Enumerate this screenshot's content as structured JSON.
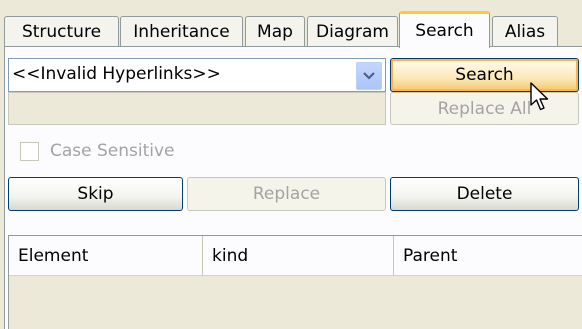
{
  "tabs": [
    {
      "label": "Structure"
    },
    {
      "label": "Inheritance"
    },
    {
      "label": "Map"
    },
    {
      "label": "Diagram"
    },
    {
      "label": "Search",
      "active": true
    },
    {
      "label": "Alias"
    }
  ],
  "search": {
    "combo_value": "<<Invalid Hyperlinks>>",
    "replace_value": "",
    "case_sensitive_label": "Case Sensitive",
    "case_sensitive_checked": false
  },
  "buttons": {
    "search": "Search",
    "replace_all": "Replace All",
    "skip": "Skip",
    "replace": "Replace",
    "delete": "Delete"
  },
  "results_table": {
    "columns": [
      "Element",
      "kind",
      "Parent"
    ],
    "rows": []
  },
  "colors": {
    "panel_bg": "#fcfcfe",
    "window_bg": "#ece9d8",
    "active_tab_accent": "#ffc83c",
    "button_border": "#003c74",
    "focus_highlight": "#f9b34f",
    "disabled_text": "#a3a3a3"
  }
}
